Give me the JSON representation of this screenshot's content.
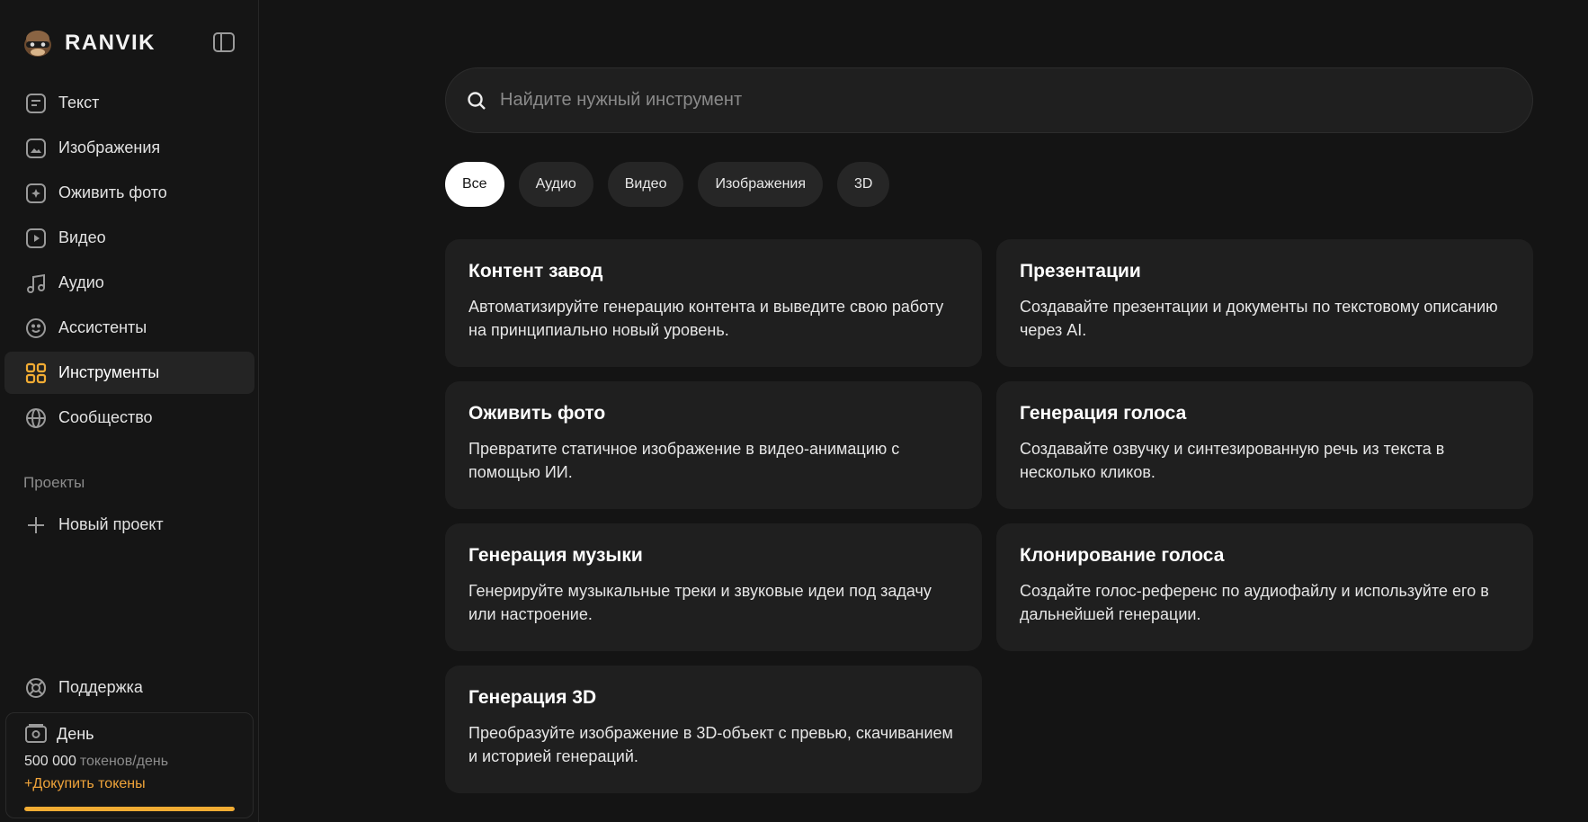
{
  "brand": {
    "name": "RANVIK"
  },
  "sidebar": {
    "items": [
      {
        "label": "Текст",
        "icon": "text-icon"
      },
      {
        "label": "Изображения",
        "icon": "image-icon"
      },
      {
        "label": "Оживить фото",
        "icon": "animate-photo-icon"
      },
      {
        "label": "Видео",
        "icon": "video-play-icon"
      },
      {
        "label": "Аудио",
        "icon": "music-note-icon"
      },
      {
        "label": "Ассистенты",
        "icon": "smile-icon"
      },
      {
        "label": "Инструменты",
        "icon": "grid-icon",
        "active": true
      },
      {
        "label": "Сообщество",
        "icon": "globe-icon"
      }
    ],
    "projects_label": "Проекты",
    "new_project_label": "Новый проект",
    "support_label": "Поддержка",
    "plan": {
      "name": "День",
      "tokens": "500 000",
      "tokens_unit": "токенов/день",
      "buy_label": "+Докупить токены",
      "usage_fraction": 1.0
    }
  },
  "search": {
    "placeholder": "Найдите нужный инструмент",
    "value": ""
  },
  "filters": [
    {
      "label": "Все",
      "active": true
    },
    {
      "label": "Аудио"
    },
    {
      "label": "Видео"
    },
    {
      "label": "Изображения"
    },
    {
      "label": "3D"
    }
  ],
  "tools": [
    {
      "title": "Контент завод",
      "description": "Автоматизируйте генерацию контента и выведите свою работу на принципиально новый уровень."
    },
    {
      "title": "Презентации",
      "description": "Создавайте презентации и документы по текстовому описанию через AI."
    },
    {
      "title": "Оживить фото",
      "description": "Превратите статичное изображение в видео-анимацию с помощью ИИ."
    },
    {
      "title": "Генерация голоса",
      "description": "Создавайте озвучку и синтезированную речь из текста в несколько кликов."
    },
    {
      "title": "Генерация музыки",
      "description": "Генерируйте музыкальные треки и звуковые идеи под задачу или настроение."
    },
    {
      "title": "Клонирование голоса",
      "description": "Создайте голос-референс по аудиофайлу и используйте его в дальнейшей генерации."
    },
    {
      "title": "Генерация 3D",
      "description": "Преобразуйте изображение в 3D-объект с превью, скачиванием и историей генераций."
    }
  ],
  "colors": {
    "accent": "#f2ac33",
    "background": "#141414",
    "card": "#1f1f1f"
  }
}
